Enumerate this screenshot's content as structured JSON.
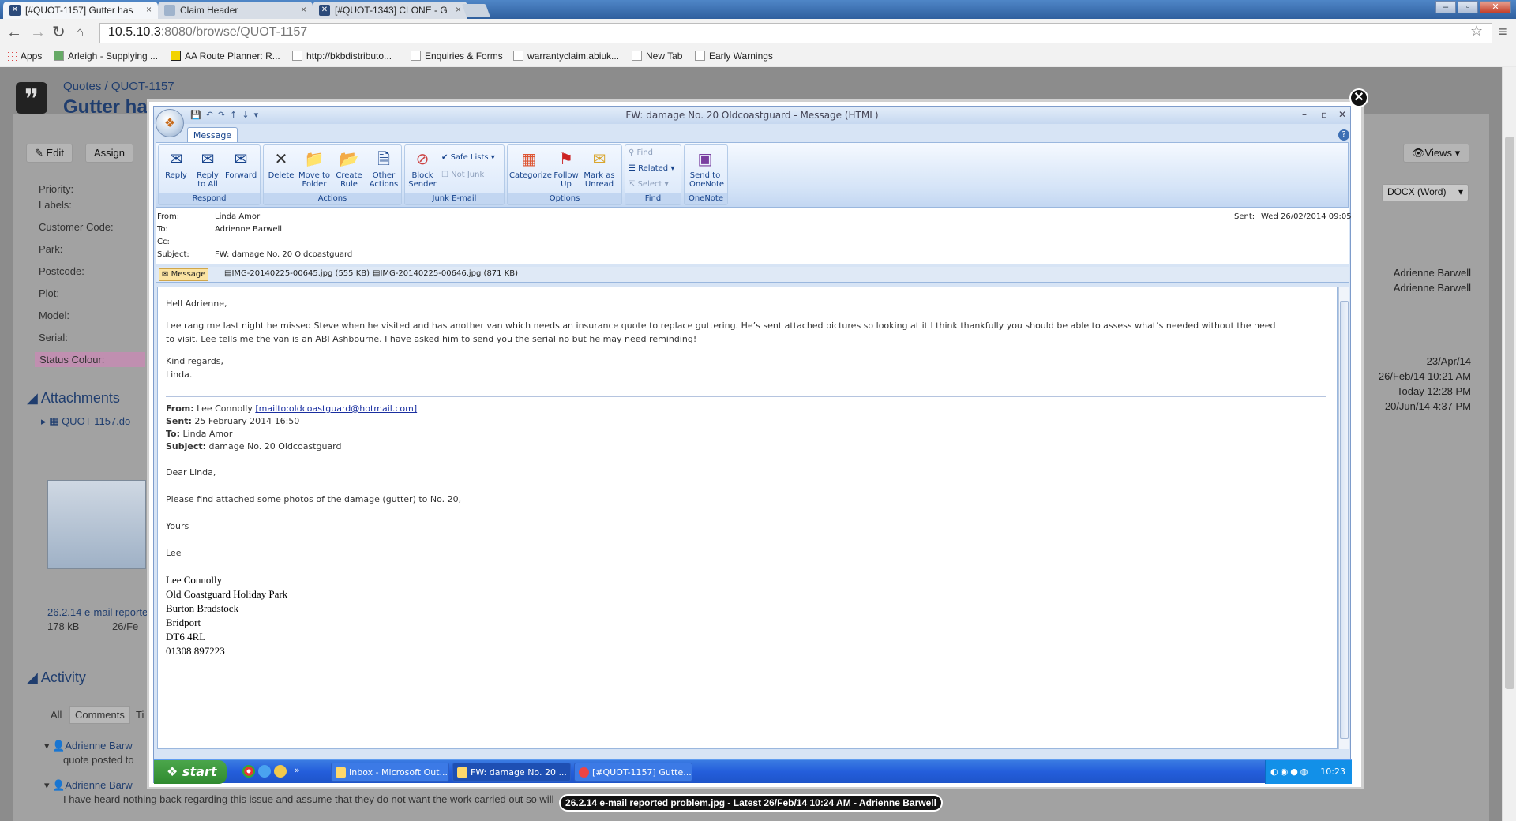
{
  "browser": {
    "tabs": [
      {
        "label": "[#QUOT-1157] Gutter has"
      },
      {
        "label": "Claim Header"
      },
      {
        "label": "[#QUOT-1343] CLONE - G"
      }
    ],
    "url_host": "10.5.10.3",
    "url_path": ":8080/browse/QUOT-1157",
    "bookmarks": [
      "Apps",
      "Arleigh - Supplying ...",
      "AA Route Planner: R...",
      "http://bkbdistributo...",
      "Enquiries & Forms",
      "warrantyclaim.abiuk...",
      "New Tab",
      "Early Warnings"
    ]
  },
  "jira": {
    "breadcrumb_project": "Quotes",
    "breadcrumb_sep": "/",
    "breadcrumb_key": "QUOT-1157",
    "title": "Gutter ha",
    "buttons": {
      "edit": "Edit",
      "assign": "Assign",
      "views": "Views",
      "export": "DOCX (Word)"
    },
    "fields": [
      "Priority:",
      "Labels:",
      "Customer Code:",
      "Park:",
      "Postcode:",
      "Plot:",
      "Model:",
      "Serial:",
      "Status Colour:"
    ],
    "attachments_title": "Attachments",
    "attachment_file": "QUOT-1157.do",
    "thumb_caption": "26.2.14 e-mail reporte",
    "thumb_size": "178 kB",
    "thumb_date": "26/Fe",
    "activity_title": "Activity",
    "activity_tabs": [
      "All",
      "Comments",
      "Ti"
    ],
    "comment1_author": "Adrienne Barw",
    "comment1_text": "quote posted to",
    "comment2_author": "Adrienne Barw",
    "comment2_text": "I have heard nothing back regarding this issue and assume that they do not want the work carried out so will",
    "people": [
      "Adrienne Barwell",
      "Adrienne Barwell"
    ],
    "dates": [
      "23/Apr/14",
      "26/Feb/14 10:21 AM",
      "Today 12:28 PM",
      "20/Jun/14 4:37 PM"
    ]
  },
  "outlook": {
    "window_title": "FW: damage No. 20 Oldcoastguard - Message (HTML)",
    "ribbon_tab": "Message",
    "groups": {
      "respond": {
        "label": "Respond",
        "reply": "Reply",
        "reply_all": "Reply\nto All",
        "forward": "Forward"
      },
      "actions": {
        "label": "Actions",
        "delete": "Delete",
        "move": "Move to\nFolder",
        "rule": "Create\nRule",
        "other": "Other\nActions"
      },
      "junk": {
        "label": "Junk E-mail",
        "block": "Block\nSender",
        "safe": "Safe Lists",
        "notjunk": "Not Junk"
      },
      "options": {
        "label": "Options",
        "categorize": "Categorize",
        "follow": "Follow\nUp",
        "unread": "Mark as\nUnread"
      },
      "find": {
        "label": "Find",
        "find": "Find",
        "related": "Related",
        "select": "Select"
      },
      "onenote": {
        "label": "OneNote",
        "send": "Send to\nOneNote"
      }
    },
    "header": {
      "from_label": "From:",
      "from": "Linda Amor",
      "to_label": "To:",
      "to": "Adrienne Barwell",
      "cc_label": "Cc:",
      "subject_label": "Subject:",
      "subject": "FW: damage No. 20 Oldcoastguard",
      "sent_label": "Sent:",
      "sent": "Wed 26/02/2014 09:05"
    },
    "attachments": [
      "Message",
      "IMG-20140225-00645.jpg (555 KB)",
      "IMG-20140225-00646.jpg (871 KB)"
    ],
    "body": {
      "greeting": "Hell Adrienne,",
      "line1": "Lee rang me last night he missed Steve when he visited and has another van which needs an insurance quote to replace guttering.  He’s sent attached pictures so looking at it I think thankfully you should be able to assess what’s needed without the need",
      "line2": "to visit.  Lee tells me the van is an ABI Ashbourne.  I have asked him to send you the serial no but he may need reminding!",
      "regards": "Kind regards,",
      "sig": "Linda.",
      "fw_from_label": "From:",
      "fw_from": "Lee Connolly ",
      "fw_email": "[mailto:oldcoastguard@hotmail.com]",
      "fw_sent_label": "Sent:",
      "fw_sent": "25 February 2014 16:50",
      "fw_to_label": "To:",
      "fw_to": "Linda Amor",
      "fw_subject_label": "Subject:",
      "fw_subject": "damage No. 20 Oldcoastguard",
      "dear": "Dear Linda,",
      "please": "Please find attached some photos of the damage (gutter) to No. 20,",
      "yours": "Yours",
      "lee": "Lee",
      "address": [
        "Lee Connolly",
        "Old Coastguard Holiday Park",
        "Burton Bradstock",
        "Bridport",
        "DT6 4RL",
        "01308 897223"
      ]
    }
  },
  "taskbar": {
    "start": "start",
    "items": [
      "Inbox - Microsoft Out...",
      "FW: damage No. 20 ...",
      "[#QUOT-1157] Gutte..."
    ],
    "clock": "10:23"
  },
  "caption": "26.2.14 e-mail reported problem.jpg - Latest 26/Feb/14 10:24 AM - Adrienne Barwell"
}
